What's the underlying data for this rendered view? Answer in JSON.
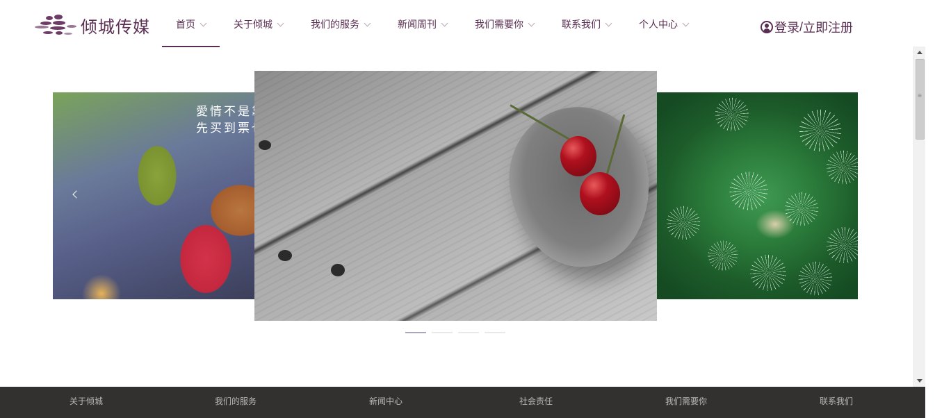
{
  "brand": {
    "name": "倾城传媒",
    "logo_icon": "dandelion-logo-icon"
  },
  "nav": {
    "items": [
      {
        "label": "首页",
        "active": true
      },
      {
        "label": "关于倾城",
        "active": false
      },
      {
        "label": "我们的服务",
        "active": false
      },
      {
        "label": "新闻周刊",
        "active": false
      },
      {
        "label": "我们需要你",
        "active": false
      },
      {
        "label": "联系我们",
        "active": false
      },
      {
        "label": "个人中心",
        "active": false
      }
    ]
  },
  "auth": {
    "icon": "user-circle-icon",
    "login": "登录",
    "separator": " /",
    "register": "立即注册"
  },
  "carousel": {
    "left_slide": {
      "image": "autumn-leaves-photo",
      "overlay_text_line1": "愛情不是靠",
      "overlay_text_line2": "先买到票也"
    },
    "center_slide": {
      "image": "cherries-in-bowl-photo"
    },
    "right_slide": {
      "image": "dandelion-photo"
    },
    "indicator_count": 4,
    "active_index": 0
  },
  "footer": {
    "links": [
      "关于倾城",
      "我们的服务",
      "新闻中心",
      "社会责任",
      "我们需要你",
      "联系我们"
    ]
  },
  "colors": {
    "brand": "#5a2d52",
    "footer_bg": "#333030",
    "footer_text": "#b9b5b5"
  }
}
